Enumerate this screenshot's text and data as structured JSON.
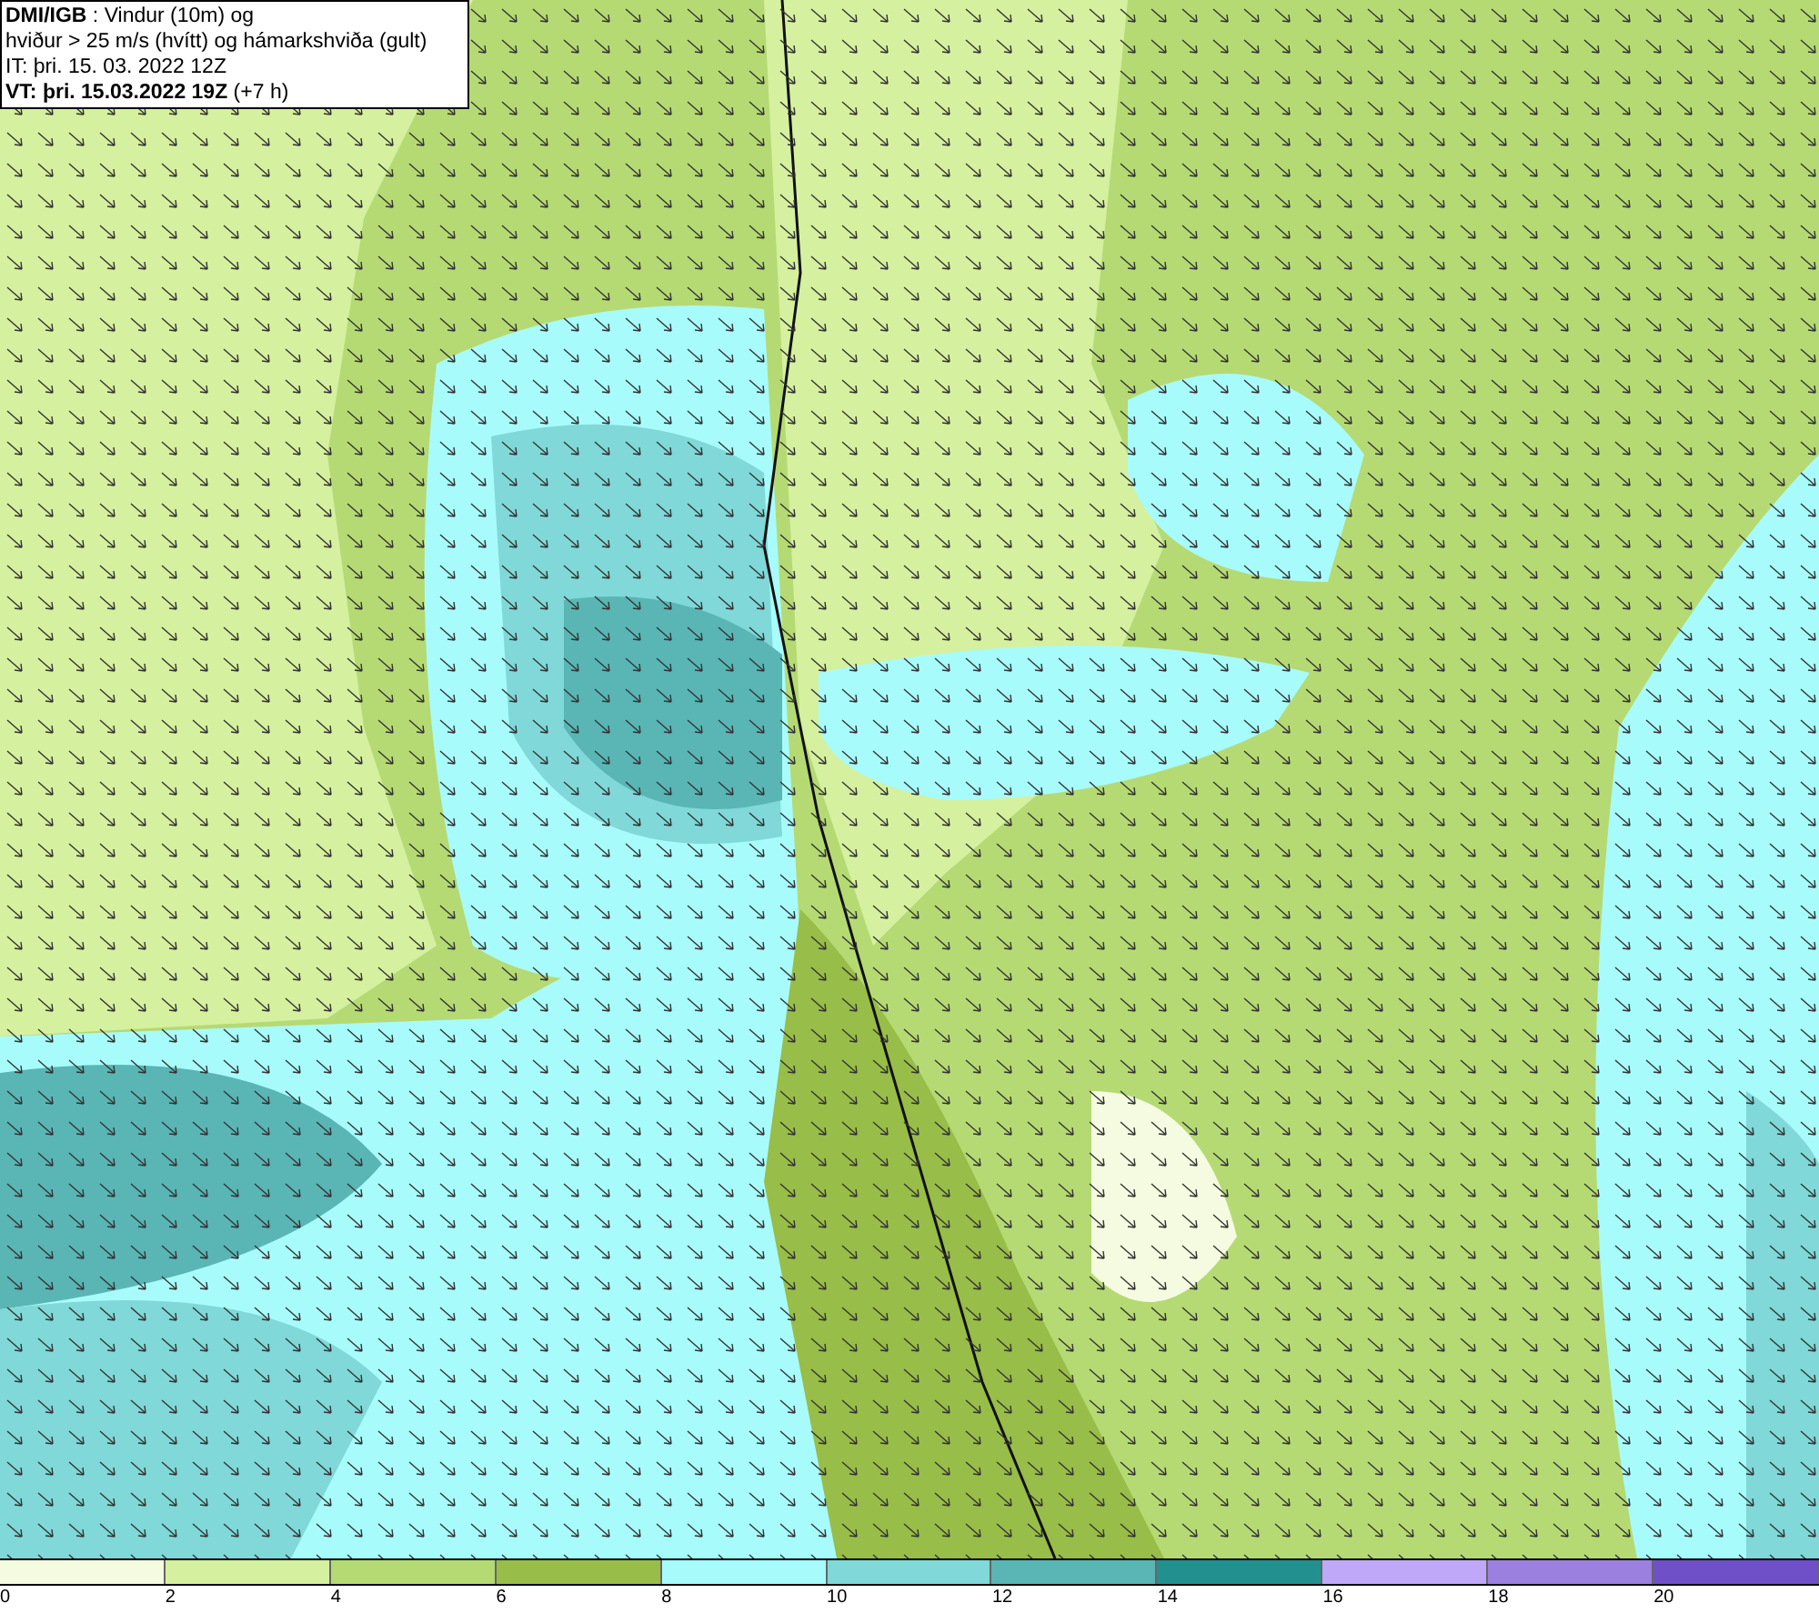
{
  "title_box": {
    "lines": [
      "**DMI/IGB** : Vindur (10m) og",
      "hviður > 25 m/s (hvítt) og hámarkshviða (gult)",
      "IT: þri. 15. 03. 2022 12Z",
      "**VT: þri. 15.03.2022 19Z** (+7 h)"
    ]
  },
  "legend": {
    "bins": [
      {
        "color": "#f5fbe0"
      },
      {
        "color": "#d5f09f"
      },
      {
        "color": "#b5da74"
      },
      {
        "color": "#98bd48"
      },
      {
        "color": "#a8fbfb"
      },
      {
        "color": "#80d8d8"
      },
      {
        "color": "#5ab5b5"
      },
      {
        "color": "#239090"
      },
      {
        "color": "#c0a8f8"
      },
      {
        "color": "#9c80e0"
      },
      {
        "color": "#7050c8"
      }
    ],
    "ticks": [
      "0",
      "2",
      "4",
      "6",
      "8",
      "10",
      "12",
      "14",
      "16",
      "18",
      "20"
    ]
  }
}
